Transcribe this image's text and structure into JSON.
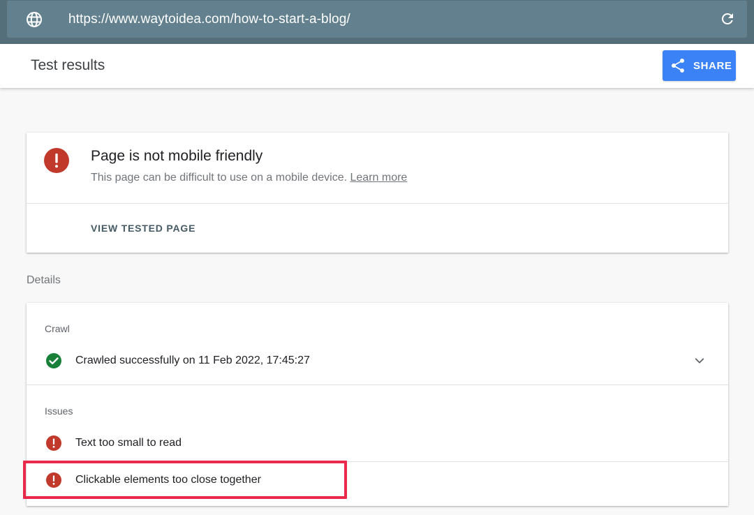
{
  "browser": {
    "url": "https://www.waytoidea.com/how-to-start-a-blog/",
    "globe_icon": "globe-icon",
    "reload_icon": "reload-icon"
  },
  "header": {
    "title": "Test results",
    "share_label": "SHARE",
    "share_icon": "share-icon"
  },
  "result": {
    "title": "Page is not mobile friendly",
    "description": "This page can be difficult to use on a mobile device.",
    "learn_more": "Learn more",
    "view_tested_page": "VIEW TESTED PAGE",
    "status_icon": "error-icon"
  },
  "details": {
    "label": "Details",
    "crawl": {
      "label": "Crawl",
      "status": "Crawled successfully on 11 Feb 2022, 17:45:27",
      "status_icon": "check-circle-icon"
    },
    "issues": {
      "label": "Issues",
      "items": [
        {
          "text": "Text too small to read",
          "icon": "error-icon"
        },
        {
          "text": "Clickable elements too close together",
          "icon": "error-icon"
        }
      ]
    }
  },
  "colors": {
    "url_bar": "#546e7a",
    "share_button": "#3b82f6",
    "error": "#c0392b",
    "success": "#188038",
    "highlight": "#e8294a"
  }
}
